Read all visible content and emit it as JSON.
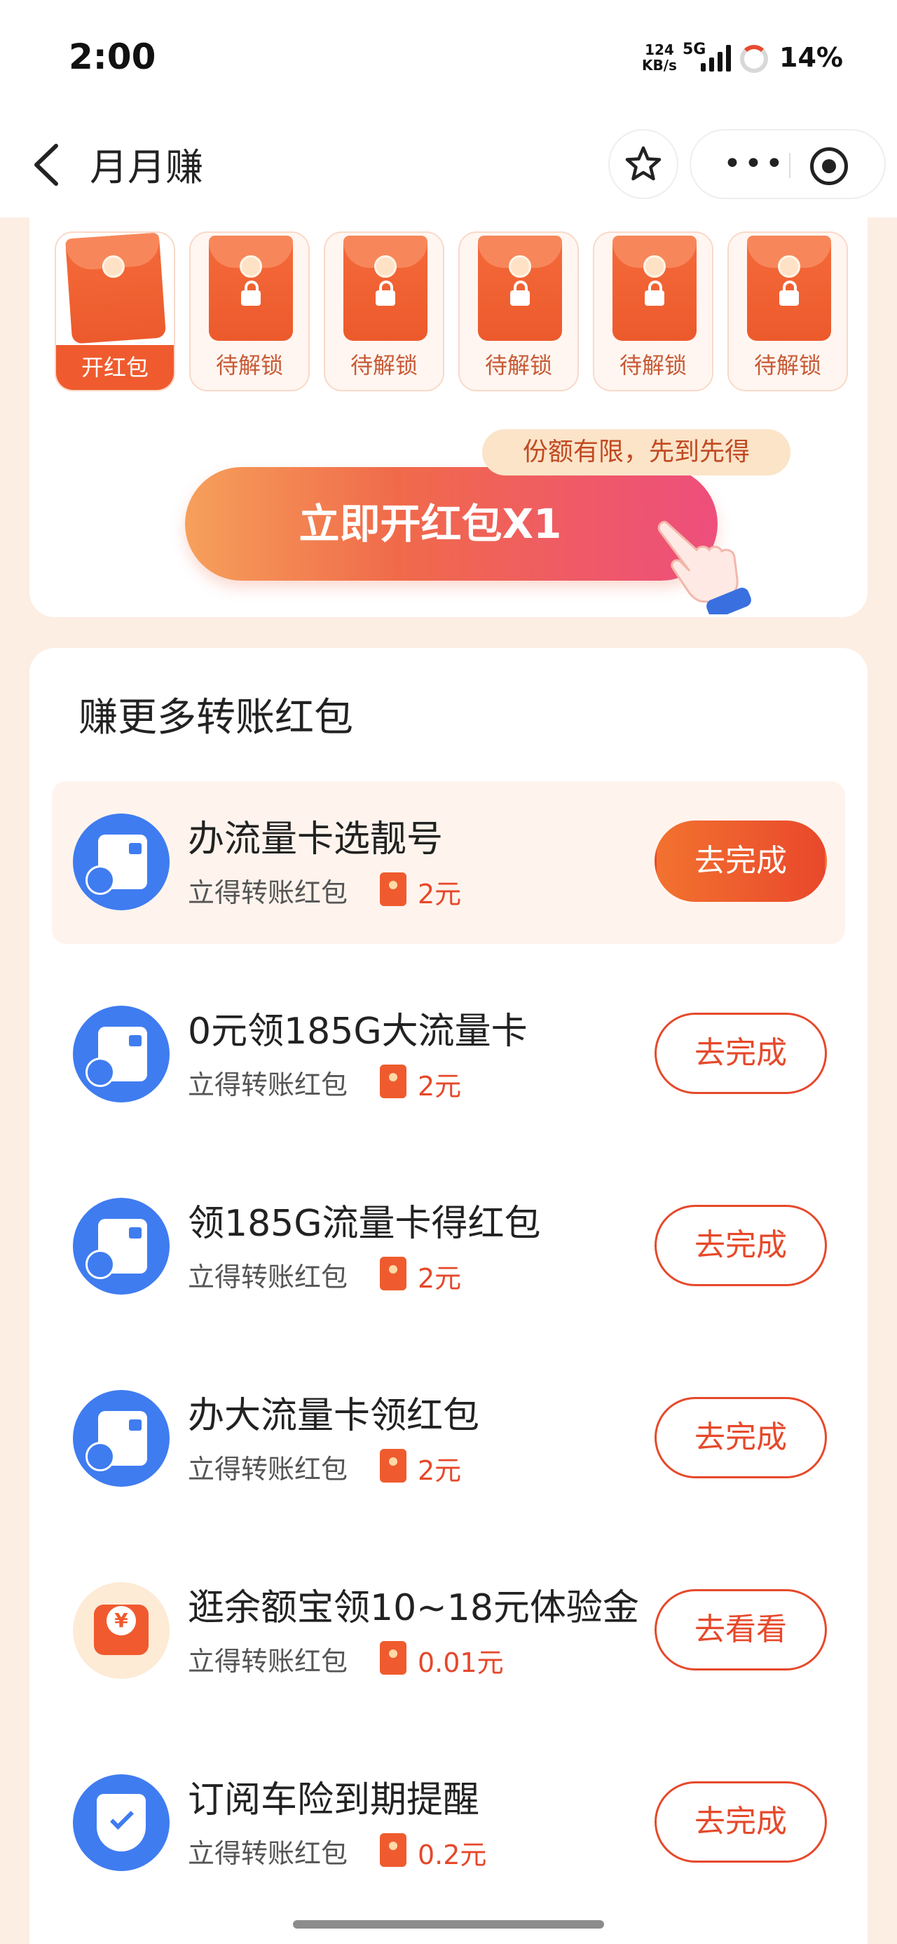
{
  "status_bar": {
    "time": "2:00",
    "net_speed_value": "124",
    "net_speed_unit": "KB/s",
    "network": "5G",
    "battery": "14%"
  },
  "nav": {
    "title": "月月赚",
    "back_icon": "chevron-left-icon",
    "favorite_icon": "star-icon",
    "more_icon": "more-dots-icon",
    "close_icon": "target-circle-icon"
  },
  "envelopes": [
    {
      "label": "开红包",
      "state": "open"
    },
    {
      "label": "待解锁",
      "state": "locked"
    },
    {
      "label": "待解锁",
      "state": "locked"
    },
    {
      "label": "待解锁",
      "state": "locked"
    },
    {
      "label": "待解锁",
      "state": "locked"
    },
    {
      "label": "待解锁",
      "state": "locked"
    }
  ],
  "promo": {
    "limit_tag": "份额有限，先到先得",
    "open_button": "立即开红包X1"
  },
  "tasks_section": {
    "title": "赚更多转账红包",
    "items": [
      {
        "title": "办流量卡选靓号",
        "subtitle": "立得转账红包",
        "reward": "2元",
        "button": "去完成",
        "icon": "sim-card-icon"
      },
      {
        "title": "0元领185G大流量卡",
        "subtitle": "立得转账红包",
        "reward": "2元",
        "button": "去完成",
        "icon": "sim-card-icon"
      },
      {
        "title": "领185G流量卡得红包",
        "subtitle": "立得转账红包",
        "reward": "2元",
        "button": "去完成",
        "icon": "sim-card-icon"
      },
      {
        "title": "办大流量卡领红包",
        "subtitle": "立得转账红包",
        "reward": "2元",
        "button": "去完成",
        "icon": "sim-card-icon"
      },
      {
        "title": "逛余额宝领10~18元体验金",
        "subtitle": "立得转账红包",
        "reward": "0.01元",
        "button": "去看看",
        "icon": "yuan-coin-icon"
      },
      {
        "title": "订阅车险到期提醒",
        "subtitle": "立得转账红包",
        "reward": "0.2元",
        "button": "去完成",
        "icon": "shield-check-icon"
      }
    ]
  },
  "colors": {
    "accent": "#ef5b2e",
    "background": "#fdeee4",
    "icon_blue": "#3f7cf0"
  }
}
